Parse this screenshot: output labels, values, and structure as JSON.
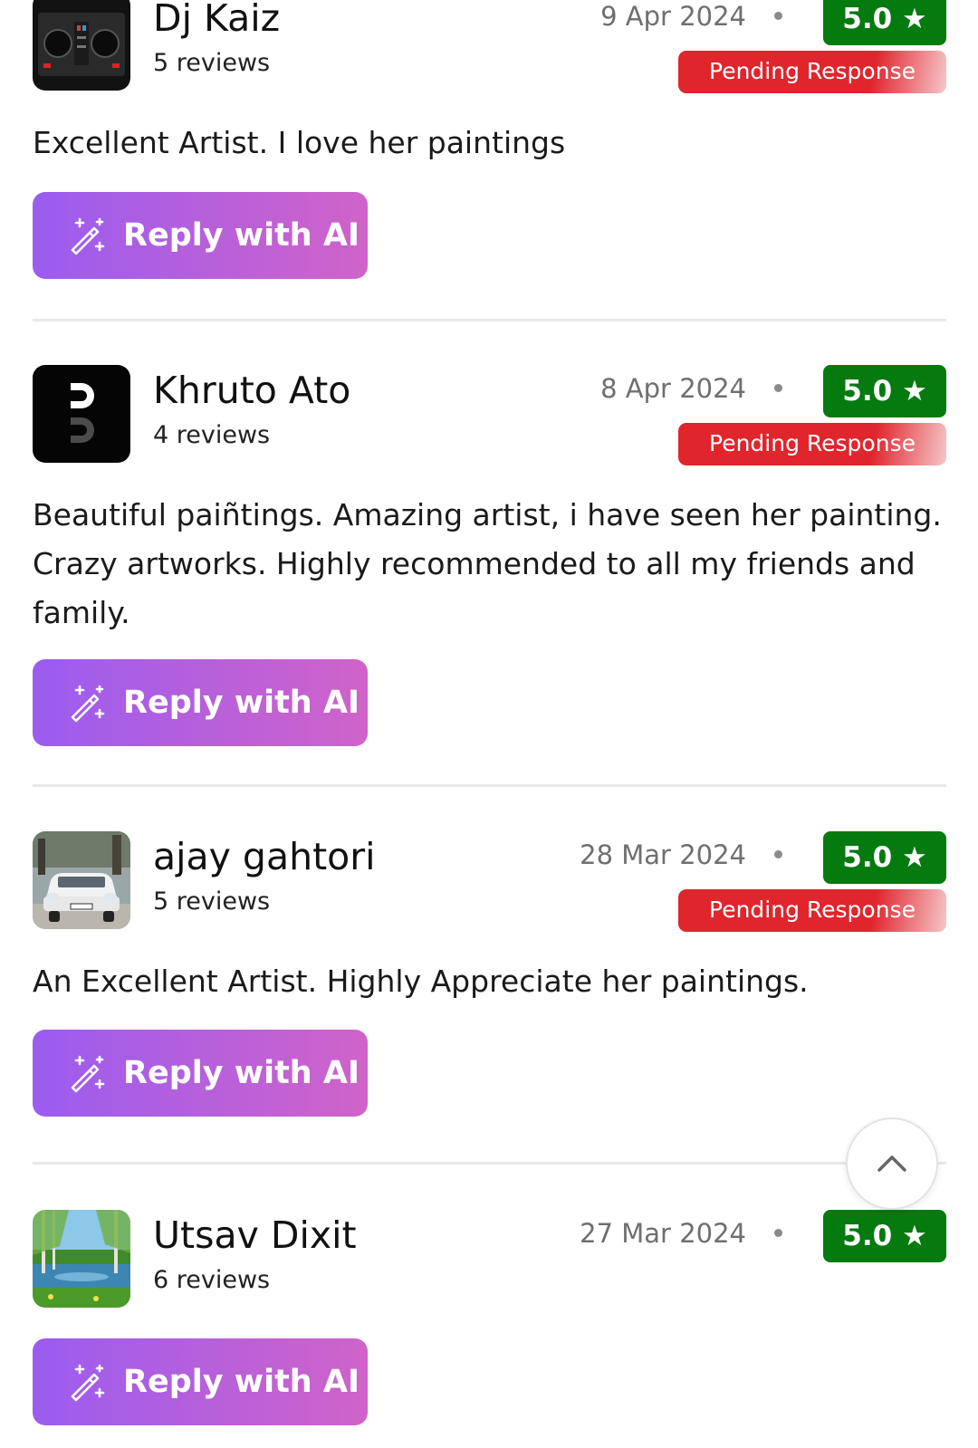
{
  "reviews": [
    {
      "name": "Dj Kaiz",
      "review_count": "5 reviews",
      "date": "9 Apr 2024",
      "rating": "5.0 ★",
      "status": "Pending Response",
      "text": "Excellent Artist. I love her paintings",
      "reply_label": "Reply with AI",
      "avatar_icon": "dj-controller-photo"
    },
    {
      "name": "Khruto Ato",
      "review_count": "4 reviews",
      "date": "8 Apr 2024",
      "rating": "5.0 ★",
      "status": "Pending Response",
      "text": "Beautiful paiñtings. Amazing artist, i have seen her painting. Crazy artworks. Highly recommended to all my friends and family.",
      "reply_label": "Reply with AI",
      "avatar_icon": "monogram-d-logo"
    },
    {
      "name": "ajay gahtori",
      "review_count": "5 reviews",
      "date": "28 Mar 2024",
      "rating": "5.0 ★",
      "status": "Pending Response",
      "text": "An Excellent Artist. Highly Appreciate her paintings.",
      "reply_label": "Reply with AI",
      "avatar_icon": "white-car-photo"
    },
    {
      "name": "Utsav Dixit",
      "review_count": "6 reviews",
      "date": "27 Mar 2024",
      "rating": "5.0 ★",
      "reply_label": "Reply with AI",
      "avatar_icon": "lake-landscape-photo"
    }
  ],
  "icons": {
    "reply": "magic-wand-icon",
    "scroll_top": "chevron-up-icon"
  },
  "colors": {
    "rating_green": "#057a0f",
    "pending_red": "#e0252d",
    "reply_gradient_start": "#9b5cf0",
    "reply_gradient_end": "#d063c8"
  }
}
